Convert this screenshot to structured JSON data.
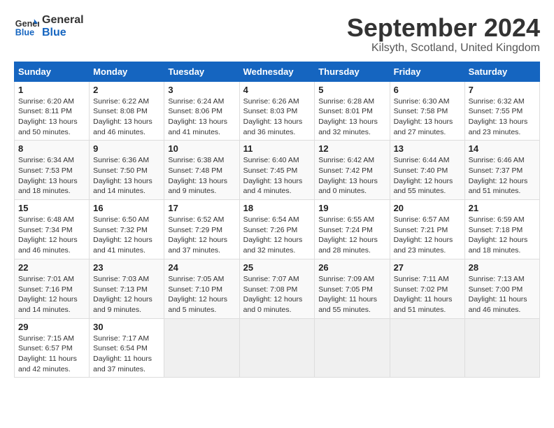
{
  "header": {
    "logo_line1": "General",
    "logo_line2": "Blue",
    "month_title": "September 2024",
    "location": "Kilsyth, Scotland, United Kingdom"
  },
  "calendar": {
    "columns": [
      "Sunday",
      "Monday",
      "Tuesday",
      "Wednesday",
      "Thursday",
      "Friday",
      "Saturday"
    ],
    "weeks": [
      [
        {
          "day": "1",
          "info": "Sunrise: 6:20 AM\nSunset: 8:11 PM\nDaylight: 13 hours\nand 50 minutes."
        },
        {
          "day": "2",
          "info": "Sunrise: 6:22 AM\nSunset: 8:08 PM\nDaylight: 13 hours\nand 46 minutes."
        },
        {
          "day": "3",
          "info": "Sunrise: 6:24 AM\nSunset: 8:06 PM\nDaylight: 13 hours\nand 41 minutes."
        },
        {
          "day": "4",
          "info": "Sunrise: 6:26 AM\nSunset: 8:03 PM\nDaylight: 13 hours\nand 36 minutes."
        },
        {
          "day": "5",
          "info": "Sunrise: 6:28 AM\nSunset: 8:01 PM\nDaylight: 13 hours\nand 32 minutes."
        },
        {
          "day": "6",
          "info": "Sunrise: 6:30 AM\nSunset: 7:58 PM\nDaylight: 13 hours\nand 27 minutes."
        },
        {
          "day": "7",
          "info": "Sunrise: 6:32 AM\nSunset: 7:55 PM\nDaylight: 13 hours\nand 23 minutes."
        }
      ],
      [
        {
          "day": "8",
          "info": "Sunrise: 6:34 AM\nSunset: 7:53 PM\nDaylight: 13 hours\nand 18 minutes."
        },
        {
          "day": "9",
          "info": "Sunrise: 6:36 AM\nSunset: 7:50 PM\nDaylight: 13 hours\nand 14 minutes."
        },
        {
          "day": "10",
          "info": "Sunrise: 6:38 AM\nSunset: 7:48 PM\nDaylight: 13 hours\nand 9 minutes."
        },
        {
          "day": "11",
          "info": "Sunrise: 6:40 AM\nSunset: 7:45 PM\nDaylight: 13 hours\nand 4 minutes."
        },
        {
          "day": "12",
          "info": "Sunrise: 6:42 AM\nSunset: 7:42 PM\nDaylight: 13 hours\nand 0 minutes."
        },
        {
          "day": "13",
          "info": "Sunrise: 6:44 AM\nSunset: 7:40 PM\nDaylight: 12 hours\nand 55 minutes."
        },
        {
          "day": "14",
          "info": "Sunrise: 6:46 AM\nSunset: 7:37 PM\nDaylight: 12 hours\nand 51 minutes."
        }
      ],
      [
        {
          "day": "15",
          "info": "Sunrise: 6:48 AM\nSunset: 7:34 PM\nDaylight: 12 hours\nand 46 minutes."
        },
        {
          "day": "16",
          "info": "Sunrise: 6:50 AM\nSunset: 7:32 PM\nDaylight: 12 hours\nand 41 minutes."
        },
        {
          "day": "17",
          "info": "Sunrise: 6:52 AM\nSunset: 7:29 PM\nDaylight: 12 hours\nand 37 minutes."
        },
        {
          "day": "18",
          "info": "Sunrise: 6:54 AM\nSunset: 7:26 PM\nDaylight: 12 hours\nand 32 minutes."
        },
        {
          "day": "19",
          "info": "Sunrise: 6:55 AM\nSunset: 7:24 PM\nDaylight: 12 hours\nand 28 minutes."
        },
        {
          "day": "20",
          "info": "Sunrise: 6:57 AM\nSunset: 7:21 PM\nDaylight: 12 hours\nand 23 minutes."
        },
        {
          "day": "21",
          "info": "Sunrise: 6:59 AM\nSunset: 7:18 PM\nDaylight: 12 hours\nand 18 minutes."
        }
      ],
      [
        {
          "day": "22",
          "info": "Sunrise: 7:01 AM\nSunset: 7:16 PM\nDaylight: 12 hours\nand 14 minutes."
        },
        {
          "day": "23",
          "info": "Sunrise: 7:03 AM\nSunset: 7:13 PM\nDaylight: 12 hours\nand 9 minutes."
        },
        {
          "day": "24",
          "info": "Sunrise: 7:05 AM\nSunset: 7:10 PM\nDaylight: 12 hours\nand 5 minutes."
        },
        {
          "day": "25",
          "info": "Sunrise: 7:07 AM\nSunset: 7:08 PM\nDaylight: 12 hours\nand 0 minutes."
        },
        {
          "day": "26",
          "info": "Sunrise: 7:09 AM\nSunset: 7:05 PM\nDaylight: 11 hours\nand 55 minutes."
        },
        {
          "day": "27",
          "info": "Sunrise: 7:11 AM\nSunset: 7:02 PM\nDaylight: 11 hours\nand 51 minutes."
        },
        {
          "day": "28",
          "info": "Sunrise: 7:13 AM\nSunset: 7:00 PM\nDaylight: 11 hours\nand 46 minutes."
        }
      ],
      [
        {
          "day": "29",
          "info": "Sunrise: 7:15 AM\nSunset: 6:57 PM\nDaylight: 11 hours\nand 42 minutes."
        },
        {
          "day": "30",
          "info": "Sunrise: 7:17 AM\nSunset: 6:54 PM\nDaylight: 11 hours\nand 37 minutes."
        },
        null,
        null,
        null,
        null,
        null
      ]
    ]
  }
}
